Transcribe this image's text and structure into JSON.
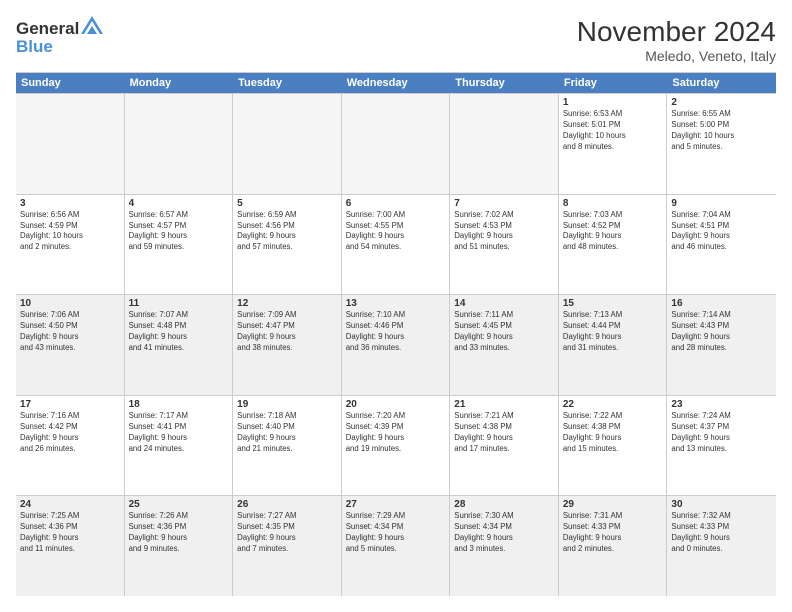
{
  "logo": {
    "line1": "General",
    "line2": "Blue"
  },
  "title": "November 2024",
  "subtitle": "Meledo, Veneto, Italy",
  "weekdays": [
    "Sunday",
    "Monday",
    "Tuesday",
    "Wednesday",
    "Thursday",
    "Friday",
    "Saturday"
  ],
  "rows": [
    [
      {
        "day": "",
        "info": "",
        "empty": true
      },
      {
        "day": "",
        "info": "",
        "empty": true
      },
      {
        "day": "",
        "info": "",
        "empty": true
      },
      {
        "day": "",
        "info": "",
        "empty": true
      },
      {
        "day": "",
        "info": "",
        "empty": true
      },
      {
        "day": "1",
        "info": "Sunrise: 6:53 AM\nSunset: 5:01 PM\nDaylight: 10 hours\nand 8 minutes."
      },
      {
        "day": "2",
        "info": "Sunrise: 6:55 AM\nSunset: 5:00 PM\nDaylight: 10 hours\nand 5 minutes."
      }
    ],
    [
      {
        "day": "3",
        "info": "Sunrise: 6:56 AM\nSunset: 4:59 PM\nDaylight: 10 hours\nand 2 minutes."
      },
      {
        "day": "4",
        "info": "Sunrise: 6:57 AM\nSunset: 4:57 PM\nDaylight: 9 hours\nand 59 minutes."
      },
      {
        "day": "5",
        "info": "Sunrise: 6:59 AM\nSunset: 4:56 PM\nDaylight: 9 hours\nand 57 minutes."
      },
      {
        "day": "6",
        "info": "Sunrise: 7:00 AM\nSunset: 4:55 PM\nDaylight: 9 hours\nand 54 minutes."
      },
      {
        "day": "7",
        "info": "Sunrise: 7:02 AM\nSunset: 4:53 PM\nDaylight: 9 hours\nand 51 minutes."
      },
      {
        "day": "8",
        "info": "Sunrise: 7:03 AM\nSunset: 4:52 PM\nDaylight: 9 hours\nand 48 minutes."
      },
      {
        "day": "9",
        "info": "Sunrise: 7:04 AM\nSunset: 4:51 PM\nDaylight: 9 hours\nand 46 minutes."
      }
    ],
    [
      {
        "day": "10",
        "info": "Sunrise: 7:06 AM\nSunset: 4:50 PM\nDaylight: 9 hours\nand 43 minutes.",
        "shaded": true
      },
      {
        "day": "11",
        "info": "Sunrise: 7:07 AM\nSunset: 4:48 PM\nDaylight: 9 hours\nand 41 minutes.",
        "shaded": true
      },
      {
        "day": "12",
        "info": "Sunrise: 7:09 AM\nSunset: 4:47 PM\nDaylight: 9 hours\nand 38 minutes.",
        "shaded": true
      },
      {
        "day": "13",
        "info": "Sunrise: 7:10 AM\nSunset: 4:46 PM\nDaylight: 9 hours\nand 36 minutes.",
        "shaded": true
      },
      {
        "day": "14",
        "info": "Sunrise: 7:11 AM\nSunset: 4:45 PM\nDaylight: 9 hours\nand 33 minutes.",
        "shaded": true
      },
      {
        "day": "15",
        "info": "Sunrise: 7:13 AM\nSunset: 4:44 PM\nDaylight: 9 hours\nand 31 minutes.",
        "shaded": true
      },
      {
        "day": "16",
        "info": "Sunrise: 7:14 AM\nSunset: 4:43 PM\nDaylight: 9 hours\nand 28 minutes.",
        "shaded": true
      }
    ],
    [
      {
        "day": "17",
        "info": "Sunrise: 7:16 AM\nSunset: 4:42 PM\nDaylight: 9 hours\nand 26 minutes."
      },
      {
        "day": "18",
        "info": "Sunrise: 7:17 AM\nSunset: 4:41 PM\nDaylight: 9 hours\nand 24 minutes."
      },
      {
        "day": "19",
        "info": "Sunrise: 7:18 AM\nSunset: 4:40 PM\nDaylight: 9 hours\nand 21 minutes."
      },
      {
        "day": "20",
        "info": "Sunrise: 7:20 AM\nSunset: 4:39 PM\nDaylight: 9 hours\nand 19 minutes."
      },
      {
        "day": "21",
        "info": "Sunrise: 7:21 AM\nSunset: 4:38 PM\nDaylight: 9 hours\nand 17 minutes."
      },
      {
        "day": "22",
        "info": "Sunrise: 7:22 AM\nSunset: 4:38 PM\nDaylight: 9 hours\nand 15 minutes."
      },
      {
        "day": "23",
        "info": "Sunrise: 7:24 AM\nSunset: 4:37 PM\nDaylight: 9 hours\nand 13 minutes."
      }
    ],
    [
      {
        "day": "24",
        "info": "Sunrise: 7:25 AM\nSunset: 4:36 PM\nDaylight: 9 hours\nand 11 minutes.",
        "shaded": true
      },
      {
        "day": "25",
        "info": "Sunrise: 7:26 AM\nSunset: 4:36 PM\nDaylight: 9 hours\nand 9 minutes.",
        "shaded": true
      },
      {
        "day": "26",
        "info": "Sunrise: 7:27 AM\nSunset: 4:35 PM\nDaylight: 9 hours\nand 7 minutes.",
        "shaded": true
      },
      {
        "day": "27",
        "info": "Sunrise: 7:29 AM\nSunset: 4:34 PM\nDaylight: 9 hours\nand 5 minutes.",
        "shaded": true
      },
      {
        "day": "28",
        "info": "Sunrise: 7:30 AM\nSunset: 4:34 PM\nDaylight: 9 hours\nand 3 minutes.",
        "shaded": true
      },
      {
        "day": "29",
        "info": "Sunrise: 7:31 AM\nSunset: 4:33 PM\nDaylight: 9 hours\nand 2 minutes.",
        "shaded": true
      },
      {
        "day": "30",
        "info": "Sunrise: 7:32 AM\nSunset: 4:33 PM\nDaylight: 9 hours\nand 0 minutes.",
        "shaded": true
      }
    ]
  ]
}
